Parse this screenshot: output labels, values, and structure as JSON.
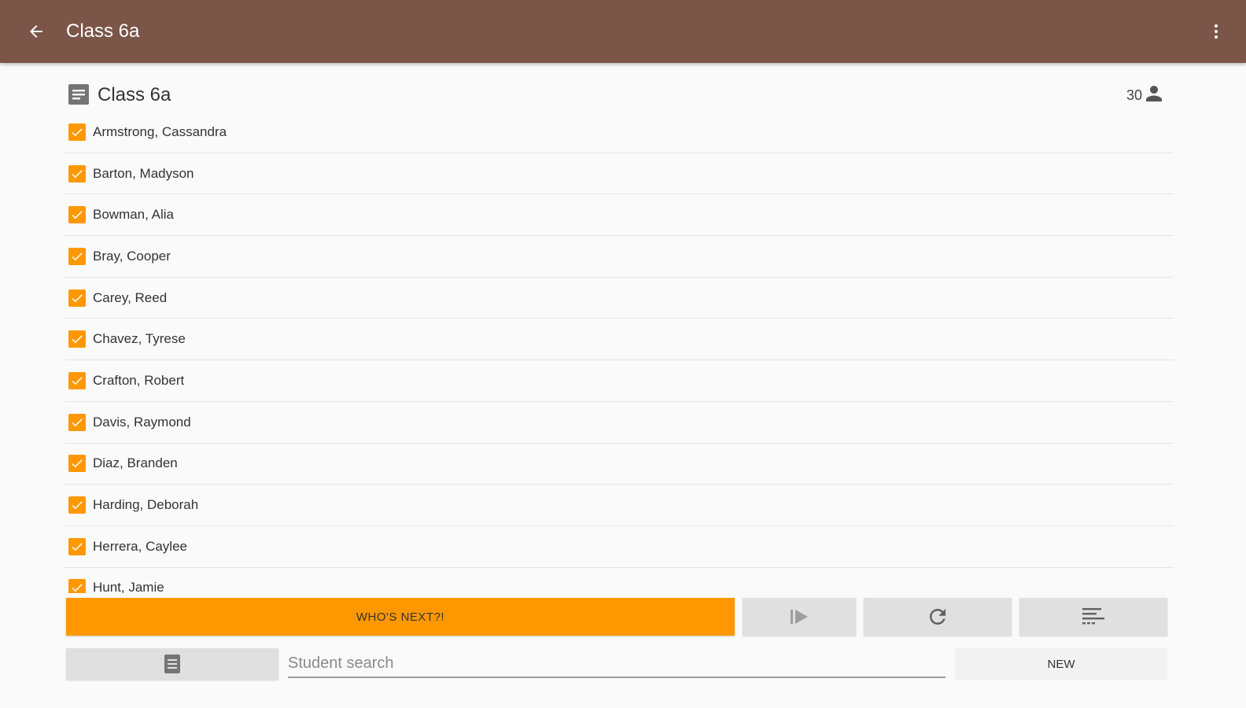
{
  "appbar": {
    "title": "Class 6a",
    "back_icon": "arrow-back-icon",
    "menu_icon": "more-vert-icon",
    "color": "#7b5547"
  },
  "class_header": {
    "title": "Class 6a",
    "student_count": "30",
    "list_icon": "class-list-icon",
    "person_icon": "person-icon"
  },
  "students": [
    {
      "name": "Armstrong, Cassandra",
      "checked": true
    },
    {
      "name": "Barton, Madyson",
      "checked": true
    },
    {
      "name": "Bowman, Alia",
      "checked": true
    },
    {
      "name": "Bray, Cooper",
      "checked": true
    },
    {
      "name": "Carey, Reed",
      "checked": true
    },
    {
      "name": "Chavez, Tyrese",
      "checked": true
    },
    {
      "name": "Crafton, Robert",
      "checked": true
    },
    {
      "name": "Davis, Raymond",
      "checked": true
    },
    {
      "name": "Diaz, Branden",
      "checked": true
    },
    {
      "name": "Harding, Deborah",
      "checked": true
    },
    {
      "name": "Herrera, Caylee",
      "checked": true
    },
    {
      "name": "Hunt, Jamie",
      "checked": true
    }
  ],
  "actions": {
    "whos_next_label": "WHO'S NEXT?!",
    "skip_icon": "skip-next-icon",
    "reset_icon": "refresh-icon",
    "sort_icon": "sort-icon",
    "accent_color": "#ff9800"
  },
  "bottom_bar": {
    "class_icon": "class-list-icon",
    "search_placeholder": "Student search",
    "search_value": "",
    "new_label": "NEW"
  }
}
